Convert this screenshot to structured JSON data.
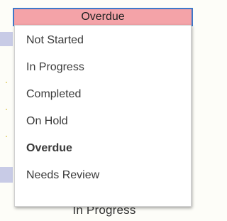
{
  "select": {
    "current_value": "Overdue",
    "highlight_color": "#f4a3a8",
    "border_color": "#3f78c9"
  },
  "options": [
    {
      "label": "Not Started"
    },
    {
      "label": "In Progress"
    },
    {
      "label": "Completed"
    },
    {
      "label": "On Hold"
    },
    {
      "label": "Overdue",
      "selected": true
    },
    {
      "label": "Needs Review"
    }
  ],
  "background": {
    "partial_cell_text": "In Progress"
  }
}
